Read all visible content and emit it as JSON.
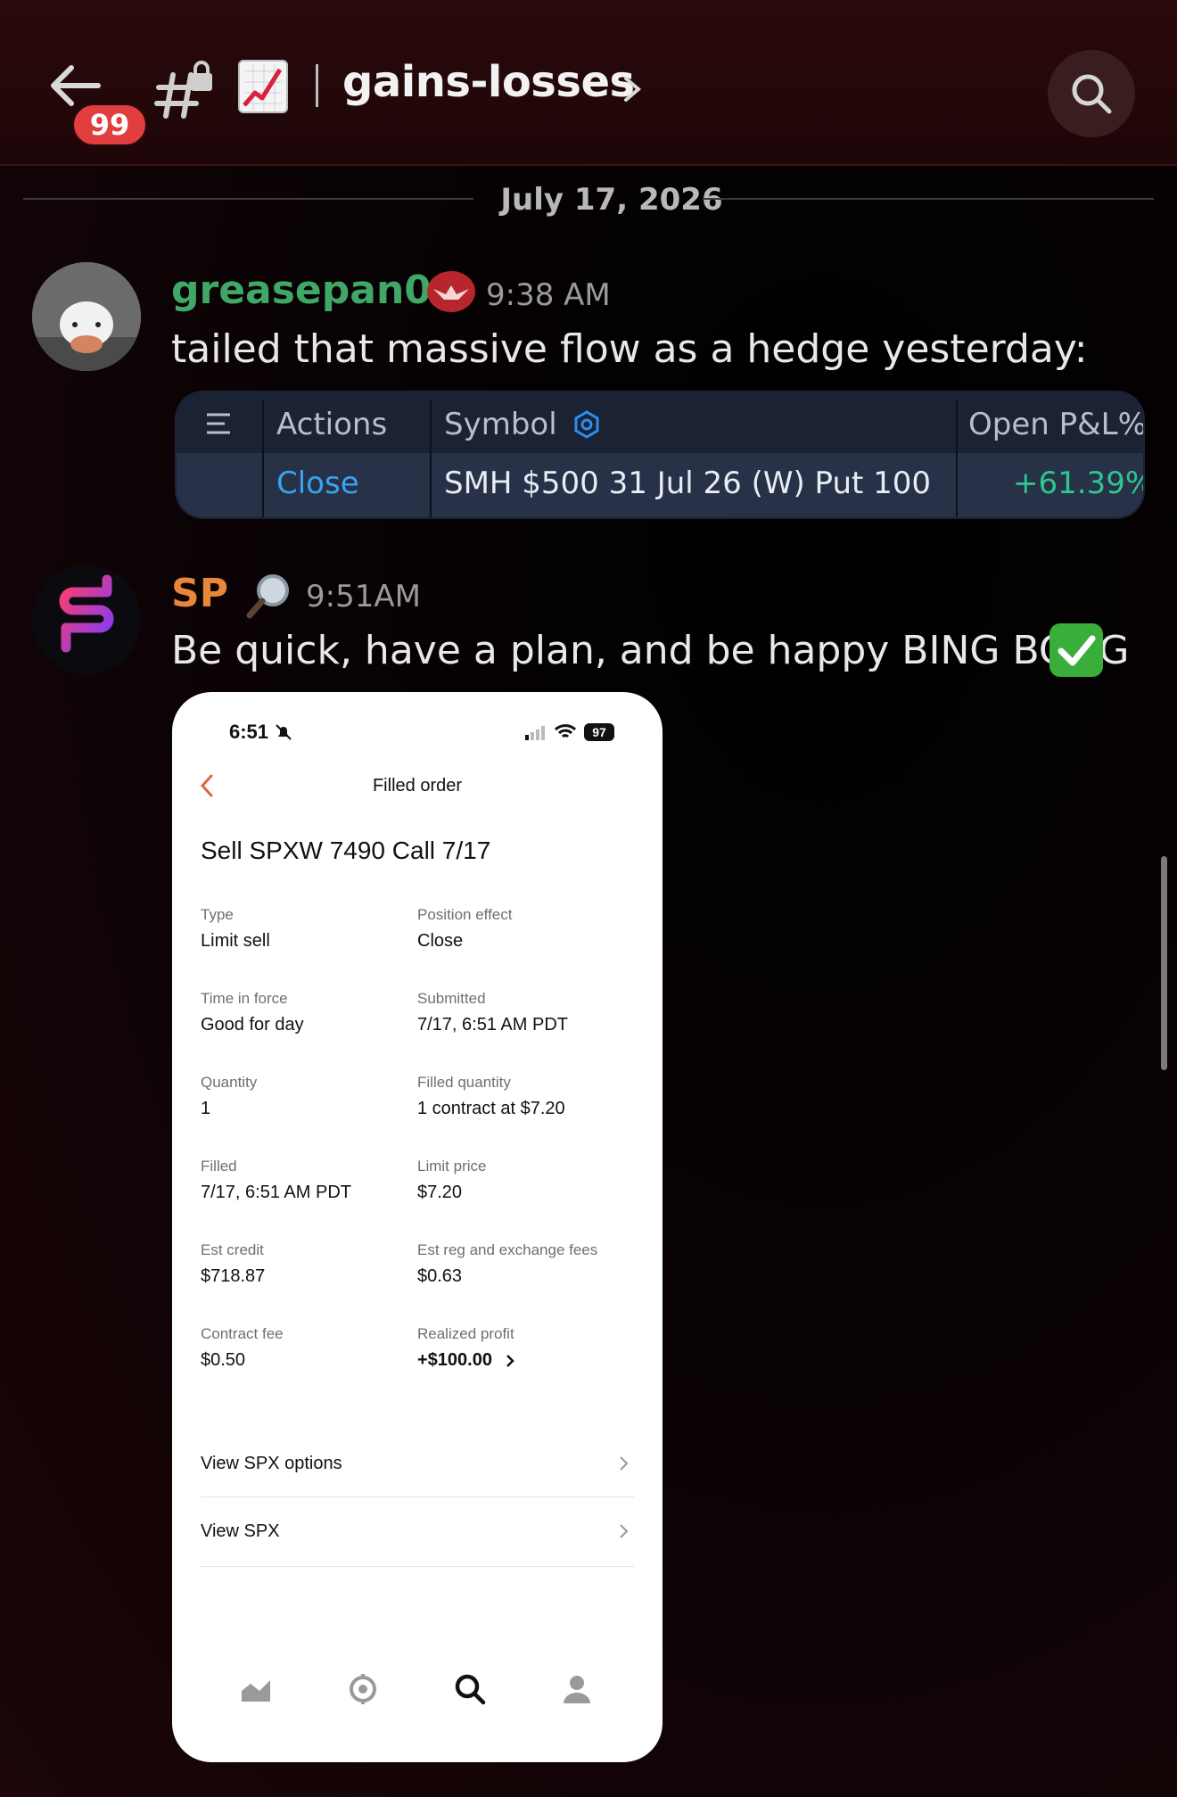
{
  "header": {
    "unread_count": "99",
    "channel_emoji": "chart-increasing-emoji",
    "channel_name": "gains-losses"
  },
  "date_divider": "July 17, 2026",
  "messages": [
    {
      "username": "greasepan01",
      "username_color": "#3fa866",
      "timestamp": "9:38 AM",
      "text": "tailed that massive flow as a hedge yesterday:",
      "attachment": {
        "columns": [
          "Actions",
          "Symbol",
          "Open P&L%"
        ],
        "row": {
          "action": "Close",
          "symbol": "SMH $500 31 Jul 26 (W) Put 100",
          "open_pnl": "+61.39%"
        }
      }
    },
    {
      "username": "SP",
      "username_color": "#e8873a",
      "timestamp": "9:51AM",
      "text": "Be quick, have a plan, and be happy BING BONG",
      "attachment": {
        "status_time": "6:51",
        "battery": "97",
        "screen_title": "Filled order",
        "order_title": "Sell SPXW 7490 Call 7/17",
        "fields": [
          {
            "label": "Type",
            "value": "Limit sell"
          },
          {
            "label": "Position effect",
            "value": "Close"
          },
          {
            "label": "Time in force",
            "value": "Good for day"
          },
          {
            "label": "Submitted",
            "value": "7/17, 6:51 AM PDT"
          },
          {
            "label": "Quantity",
            "value": "1"
          },
          {
            "label": "Filled quantity",
            "value": "1 contract at $7.20"
          },
          {
            "label": "Filled",
            "value": "7/17, 6:51 AM PDT"
          },
          {
            "label": "Limit price",
            "value": "$7.20"
          },
          {
            "label": "Est credit",
            "value": "$718.87"
          },
          {
            "label": "Est reg and exchange fees",
            "value": "$0.63"
          },
          {
            "label": "Contract fee",
            "value": "$0.50"
          },
          {
            "label": "Realized profit",
            "value": "+$100.00"
          }
        ],
        "links": [
          "View SPX options",
          "View SPX"
        ]
      }
    }
  ]
}
